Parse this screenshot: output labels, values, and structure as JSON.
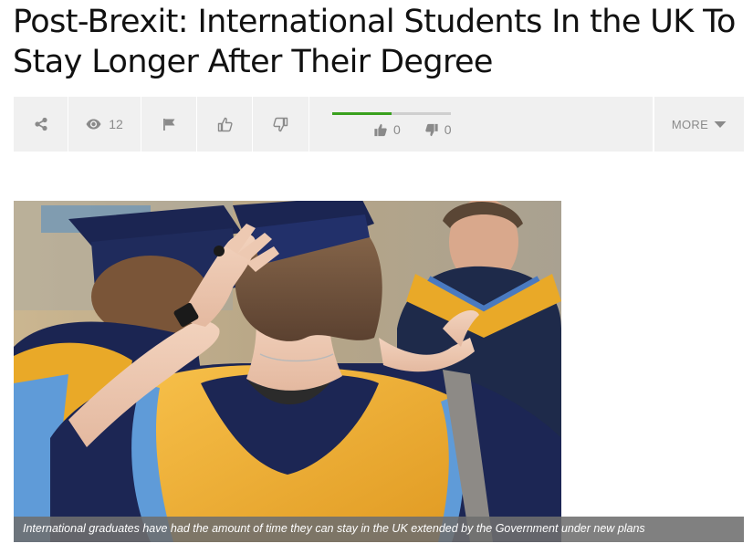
{
  "article": {
    "title": "Post-Brexit: International Students In the UK To Stay Longer After Their Degree"
  },
  "toolbar": {
    "share_icon": "share-icon",
    "views_icon": "eye-icon",
    "views_count": "12",
    "flag_icon": "flag-icon",
    "like_icon": "thumbs-up-icon",
    "dislike_icon": "thumbs-down-icon",
    "rating": {
      "likes": "0",
      "dislikes": "0",
      "like_fraction": 0.5
    },
    "more_label": "MORE",
    "more_icon": "caret-down-icon"
  },
  "image": {
    "description": "graduates-in-gowns-photo",
    "caption": "International graduates have had the amount of time they can stay in the UK extended by the Government under new plans"
  },
  "colors": {
    "rating_fill": "#3aa11e",
    "toolbar_bg": "#f0f0f0",
    "icon_gray": "#8a8a8a"
  }
}
